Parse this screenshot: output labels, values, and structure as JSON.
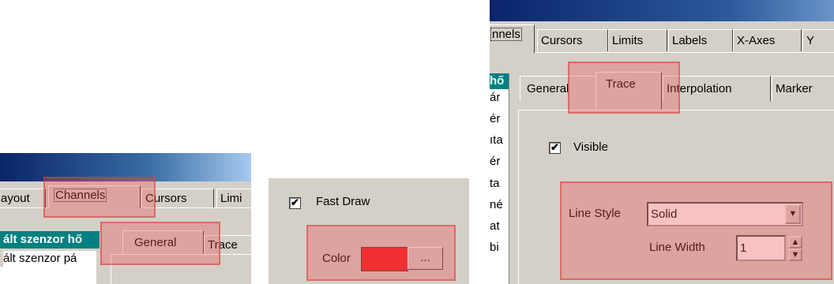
{
  "panel_left": {
    "tabs": [
      "ayout",
      "Channels",
      "Cursors",
      "Limi"
    ],
    "list_items": [
      "ált szenzor hő",
      "ált szenzor pá"
    ],
    "inner_tabs": [
      "General",
      "Trace"
    ]
  },
  "panel_middle": {
    "fast_draw_label": "Fast Draw",
    "fast_draw_checked": "✔",
    "color_label": "Color",
    "color_value": "#ee2020",
    "color_button": "..."
  },
  "panel_right": {
    "tabs": [
      "nnels",
      "Cursors",
      "Limits",
      "Labels",
      "X-Axes",
      "Y"
    ],
    "list_items": [
      "hő",
      "ár",
      "ér",
      "ıta",
      "ér",
      "ta",
      "né",
      "at",
      "bi"
    ],
    "inner_tabs": [
      "General",
      "Trace",
      "Interpolation",
      "Marker"
    ],
    "visible_label": "Visible",
    "visible_checked": "✔",
    "line_style_label": "Line Style",
    "line_style_value": "Solid",
    "line_width_label": "Line Width",
    "line_width_value": "1",
    "dropdown_arrow": "▼",
    "spin_up": "▲",
    "spin_down": "▼"
  }
}
